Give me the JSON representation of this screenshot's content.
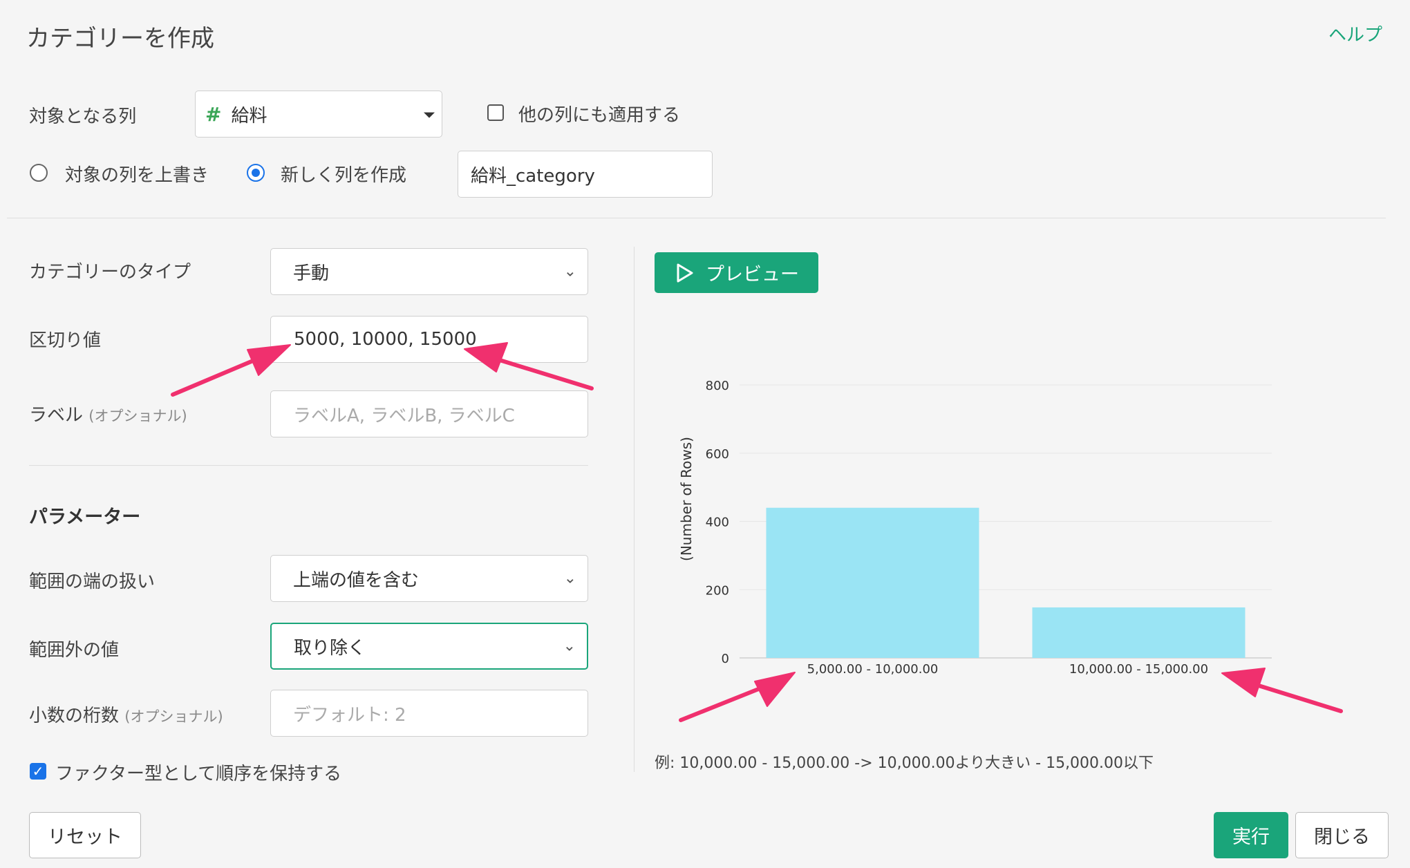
{
  "dialog": {
    "title": "カテゴリーを作成",
    "help_label": "ヘルプ"
  },
  "target": {
    "label": "対象となる列",
    "column_icon": "#",
    "column_value": "給料",
    "apply_other_label": "他の列にも適用する",
    "apply_other_checked": false
  },
  "output": {
    "overwrite_label": "対象の列を上書き",
    "new_column_label": "新しく列を作成",
    "selected": "new",
    "new_column_name": "給料_category"
  },
  "form": {
    "category_type_label": "カテゴリーのタイプ",
    "category_type_value": "手動",
    "breaks_label": "区切り値",
    "breaks_value": "5000, 10000, 15000",
    "labels_label": "ラベル",
    "labels_optional": "(オプショナル)",
    "labels_placeholder": "ラベルA, ラベルB, ラベルC"
  },
  "params": {
    "heading": "パラメーター",
    "edge_label": "範囲の端の扱い",
    "edge_value": "上端の値を含む",
    "outside_label": "範囲外の値",
    "outside_value": "取り除く",
    "digits_label": "小数の桁数",
    "digits_optional": "(オプショナル)",
    "digits_placeholder": "デフォルト: 2",
    "factor_label": "ファクター型として順序を保持する",
    "factor_checked": true
  },
  "preview": {
    "button_label": "プレビュー"
  },
  "chart_data": {
    "type": "bar",
    "categories": [
      "5,000.00 - 10,000.00",
      "10,000.00 - 15,000.00"
    ],
    "values": [
      440,
      148
    ],
    "ylabel": "(Number of Rows)",
    "xlabel": "",
    "ylim": [
      0,
      800
    ],
    "yticks": [
      0,
      200,
      400,
      600,
      800
    ],
    "bar_color": "#9ae4f4",
    "grid": true
  },
  "example_note": "例: 10,000.00 - 15,000.00 -> 10,000.00より大きい - 15,000.00以下",
  "footer": {
    "reset_label": "リセット",
    "run_label": "実行",
    "close_label": "閉じる"
  },
  "colors": {
    "accent": "#1aa57a",
    "annotation": "#f0306e",
    "bar": "#9ae4f4"
  }
}
